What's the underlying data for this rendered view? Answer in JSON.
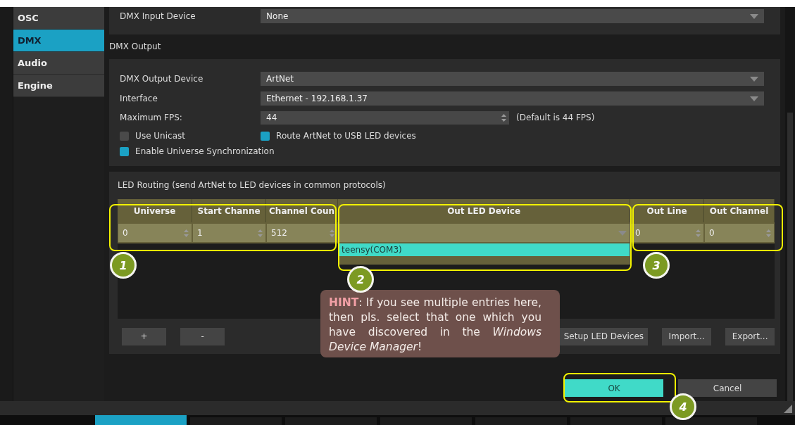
{
  "sidebar": {
    "items": [
      {
        "label": "OSC",
        "selected": false
      },
      {
        "label": "DMX",
        "selected": true
      },
      {
        "label": "Audio",
        "selected": false
      },
      {
        "label": "Engine",
        "selected": false
      }
    ]
  },
  "dmx_input": {
    "label": "DMX Input Device",
    "value": "None"
  },
  "dmx_output": {
    "title": "DMX Output",
    "fields": [
      {
        "kind": "dropdown",
        "label": "DMX Output Device",
        "value": "ArtNet"
      },
      {
        "kind": "dropdown",
        "label": "Interface",
        "value": "Ethernet - 192.168.1.37"
      },
      {
        "kind": "spinner",
        "label": "Maximum FPS:",
        "value": "44",
        "note": "(Default is 44 FPS)"
      }
    ],
    "checkboxes": [
      {
        "label": "Use Unicast",
        "checked": false
      },
      {
        "label": "Route ArtNet to USB LED devices",
        "checked": true
      },
      {
        "label": "Enable Universe Synchronization",
        "checked": true
      }
    ]
  },
  "led_routing": {
    "title": "LED Routing (send ArtNet to LED devices in common protocols)",
    "columns": [
      "Universe",
      "Start Channe",
      "Channel Coun",
      "Out LED Device",
      "Out Line",
      "Out Channel"
    ],
    "rows": [
      {
        "cells": [
          {
            "kind": "spinner",
            "value": "0"
          },
          {
            "kind": "spinner",
            "value": "1"
          },
          {
            "kind": "spinner",
            "value": "512"
          },
          {
            "kind": "dropdown"
          },
          {
            "kind": "spinner",
            "value": "0"
          },
          {
            "kind": "spinner",
            "value": "0"
          }
        ]
      }
    ],
    "device_options": [
      {
        "label": "teensy(COM3)",
        "selected": true
      }
    ],
    "buttons_left": [
      "+",
      "-"
    ],
    "buttons_right": [
      "Setup LED Devices",
      "Import...",
      "Export..."
    ]
  },
  "dialog_buttons": [
    {
      "label": "OK",
      "default": true
    },
    {
      "label": "Cancel",
      "default": false
    }
  ],
  "callouts": [
    "1",
    "2",
    "3",
    "4"
  ],
  "hint": "**HINT**: If you see multiple entries here, then pls. select that one which you have discovered in the *Windows Device Manager*!",
  "bottom_tabs": [
    {
      "selected": true
    },
    {
      "selected": false
    },
    {
      "selected": false
    },
    {
      "selected": false
    },
    {
      "selected": false
    },
    {
      "selected": false
    },
    {
      "selected": false
    }
  ]
}
